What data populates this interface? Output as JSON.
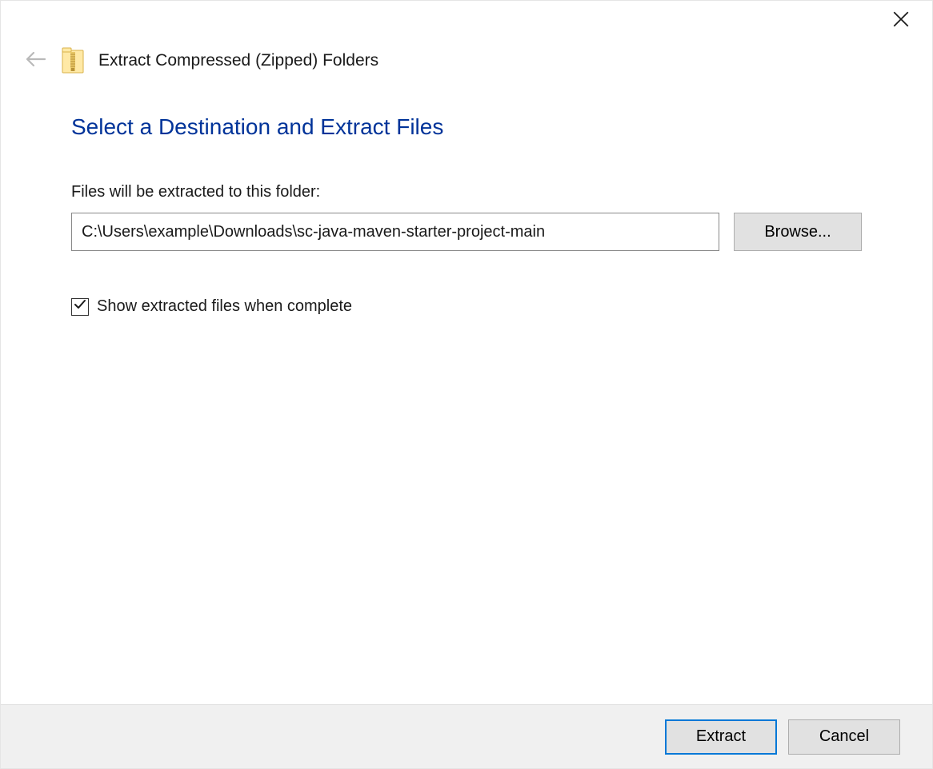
{
  "titlebar": {
    "close_icon": "close"
  },
  "header": {
    "back_icon": "back-arrow",
    "zip_icon": "zipped-folder",
    "title": "Extract Compressed (Zipped) Folders"
  },
  "main": {
    "heading": "Select a Destination and Extract Files",
    "field_label": "Files will be extracted to this folder:",
    "path_value": "C:\\Users\\example\\Downloads\\sc-java-maven-starter-project-main",
    "browse_label": "Browse...",
    "checkbox": {
      "checked": true,
      "label": "Show extracted files when complete"
    }
  },
  "footer": {
    "extract_label": "Extract",
    "cancel_label": "Cancel"
  },
  "colors": {
    "heading_blue": "#003399",
    "accent_blue": "#0078d7",
    "button_bg": "#e1e1e1",
    "footer_bg": "#f0f0f0"
  }
}
